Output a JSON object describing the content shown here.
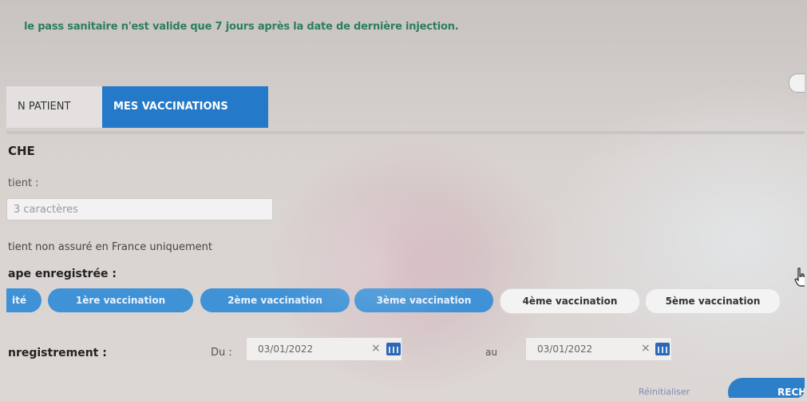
{
  "notice": "le pass sanitaire n'est valide que 7 jours après la date de dernière injection.",
  "tabs": [
    {
      "label": "N PATIENT",
      "active": false
    },
    {
      "label": "MES VACCINATIONS",
      "active": true
    }
  ],
  "section_title": "CHE",
  "patient_label": "tient :",
  "search_placeholder": "3 caractères",
  "non_assure_label": "tient non assuré en France uniquement",
  "etape_label": "ape enregistrée :",
  "stages": [
    {
      "label": "ité",
      "selected": true
    },
    {
      "label": "1ère vaccination",
      "selected": true
    },
    {
      "label": "2ème vaccination",
      "selected": true
    },
    {
      "label": "3ème vaccination",
      "selected": true
    },
    {
      "label": "4ème vaccination",
      "selected": false
    },
    {
      "label": "5ème vaccination",
      "selected": false
    }
  ],
  "date_label": "nregistrement :",
  "du_label": "Du :",
  "au_label": "au",
  "date_from": "03/01/2022",
  "date_to": "03/01/2022",
  "clear_symbol": "×",
  "reset_label": "Réinitialiser",
  "search_button_label": "RECH",
  "colors": {
    "accent": "#2479c8",
    "pill_on": "#3f92d6",
    "notice": "#2c7f5a"
  },
  "icons": [
    "calendar-icon",
    "clear-icon",
    "hand-cursor-icon"
  ]
}
